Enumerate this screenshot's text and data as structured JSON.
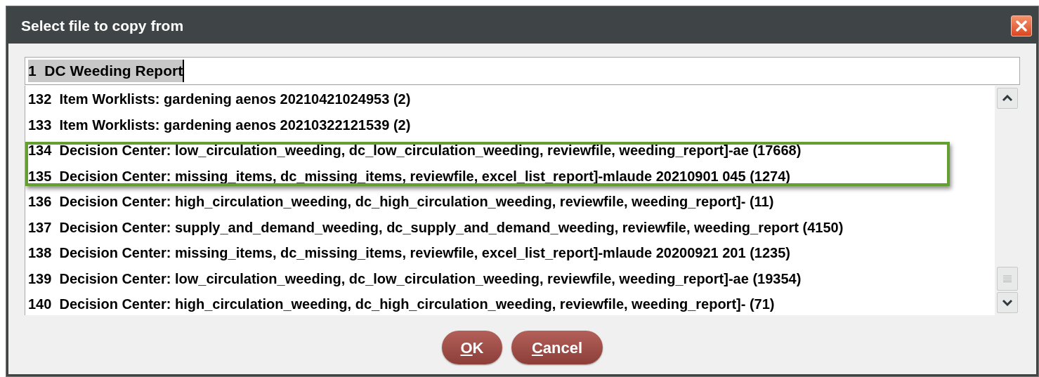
{
  "window": {
    "title": "Select file to copy from"
  },
  "field": {
    "value": "1  DC Weeding Report",
    "text_selected": true
  },
  "rows": [
    {
      "text": "132  Item Worklists: gardening aenos 20210421024953 (2)",
      "highlighted": false
    },
    {
      "text": "133  Item Worklists: gardening aenos 20210322121539 (2)",
      "highlighted": false
    },
    {
      "text": "134  Decision Center: low_circulation_weeding, dc_low_circulation_weeding, reviewfile, weeding_report]-ae (17668)",
      "highlighted": true
    },
    {
      "text": "135  Decision Center: missing_items, dc_missing_items, reviewfile, excel_list_report]-mlaude 20210901 045 (1274)",
      "highlighted": true
    },
    {
      "text": "136  Decision Center: high_circulation_weeding, dc_high_circulation_weeding, reviewfile, weeding_report]- (11)",
      "highlighted": false
    },
    {
      "text": "137  Decision Center: supply_and_demand_weeding, dc_supply_and_demand_weeding, reviewfile, weeding_report (4150)",
      "highlighted": false
    },
    {
      "text": "138  Decision Center: missing_items, dc_missing_items, reviewfile, excel_list_report]-mlaude 20200921 201 (1235)",
      "highlighted": false
    },
    {
      "text": "139  Decision Center: low_circulation_weeding, dc_low_circulation_weeding, reviewfile, weeding_report]-ae (19354)",
      "highlighted": false
    },
    {
      "text": "140  Decision Center: high_circulation_weeding, dc_high_circulation_weeding, reviewfile, weeding_report]- (71)",
      "highlighted": false
    }
  ],
  "buttons": [
    {
      "kind": "ok",
      "mnemonic": "O",
      "rest": "K"
    },
    {
      "kind": "cancel",
      "mnemonic": "C",
      "rest": "ancel"
    }
  ]
}
